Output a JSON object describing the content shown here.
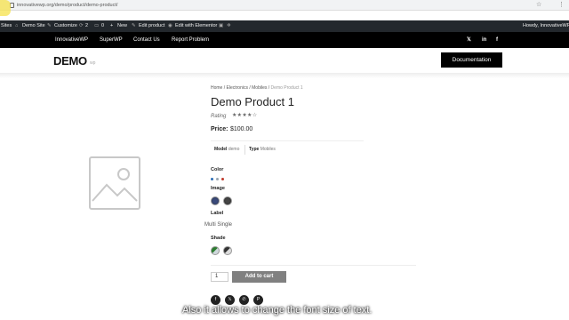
{
  "browser": {
    "url": "innovativewp.org/demo/product/demo-product/",
    "star_icon": "star-icon",
    "menu_icon": "kebab-menu-icon"
  },
  "admin_bar": {
    "sites": "Sites",
    "site_name": "Demo Site",
    "customize": "Customize",
    "comments_count": "2",
    "comments_pending": "0",
    "new": "New",
    "edit_product": "Edit product",
    "elementor": "Edit with Elementor",
    "greeting": "Howdy, InnovativeWP"
  },
  "nav": {
    "items": [
      "InnovativeWP",
      "SuperWP",
      "Contact Us",
      "Report Problem"
    ]
  },
  "header": {
    "logo": "DEMO",
    "logo_suffix": "wp",
    "doc_button": "Documentation"
  },
  "product": {
    "breadcrumb": {
      "home": "Home",
      "sep": " / ",
      "electronics": "Electronics",
      "mobiles": "Mobiles",
      "current": "Demo Product 1"
    },
    "title": "Demo Product 1",
    "rating_label": "Rating",
    "stars": "★★★★☆",
    "rating_value": 4,
    "price_label": "Price:",
    "price": "$100.00",
    "meta": [
      {
        "key": "Model",
        "value": "demo"
      },
      {
        "key": "Type",
        "value": "Mobiles"
      }
    ],
    "attributes": {
      "color_label": "Color",
      "color_options": [
        "#2d6db5",
        "#9aa6b0",
        "#c0392b"
      ],
      "image_label": "Image",
      "label_label": "Label",
      "label_options": "Multi Single",
      "shade_label": "Shade"
    },
    "quantity": "1",
    "add_to_cart": "Add to cart"
  },
  "share": [
    "facebook-icon",
    "twitter-icon",
    "whatsapp-icon",
    "pinterest-icon"
  ],
  "subtitle": "Also it allows to change the font size of text."
}
